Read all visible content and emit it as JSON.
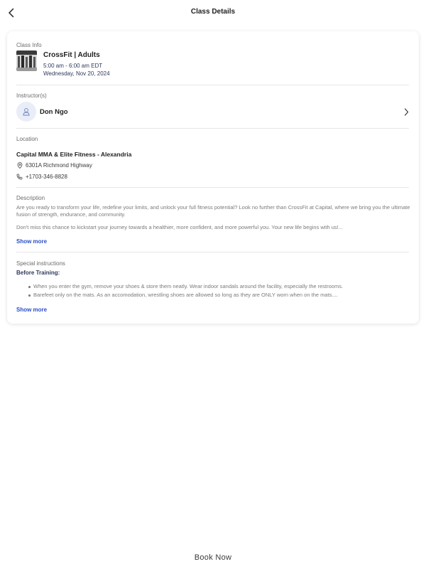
{
  "header": {
    "title": "Class Details"
  },
  "class_info": {
    "section_label": "Class Info",
    "name": "CrossFit | Adults",
    "time": "5:00 am - 6:00 am EDT",
    "date": "Wednesday, Nov 20, 2024"
  },
  "instructors": {
    "section_label": "Instructor(s)",
    "items": [
      {
        "name": "Don Ngo"
      }
    ]
  },
  "location": {
    "section_label": "Location",
    "name": "Capital MMA & Elite Fitness - Alexandria",
    "address": "6301A Richmond Highway",
    "phone": "+1703-346-8828"
  },
  "description": {
    "section_label": "Description",
    "paragraph_1": "Are you ready to transform your life, redefine your limits, and unlock your full fitness potential? Look no further than CrossFit at Capital, where we bring you the ultimate fusion of strength, endurance, and community.",
    "paragraph_2": "Don't miss this chance to kickstart your journey towards a healthier, more confident, and more powerful you. Your new life begins with us!...",
    "show_more": "Show more"
  },
  "special_instructions": {
    "section_label": "Special instructions",
    "subtitle": "Before Training:",
    "items": [
      "When you enter the gym, remove your shoes & store them neatly. Wear indoor sandals around the facility, especially the restrooms.",
      "Barefeet only on the mats. As an accomodation, wrestling shoes are allowed so long as they are ONLY worn when on the mats...."
    ],
    "show_more": "Show more"
  },
  "footer": {
    "book_now": "Book Now"
  },
  "colors": {
    "link": "#2a4fc9",
    "card_bg": "#ffffff",
    "avatar_bg": "#e9edf8"
  }
}
